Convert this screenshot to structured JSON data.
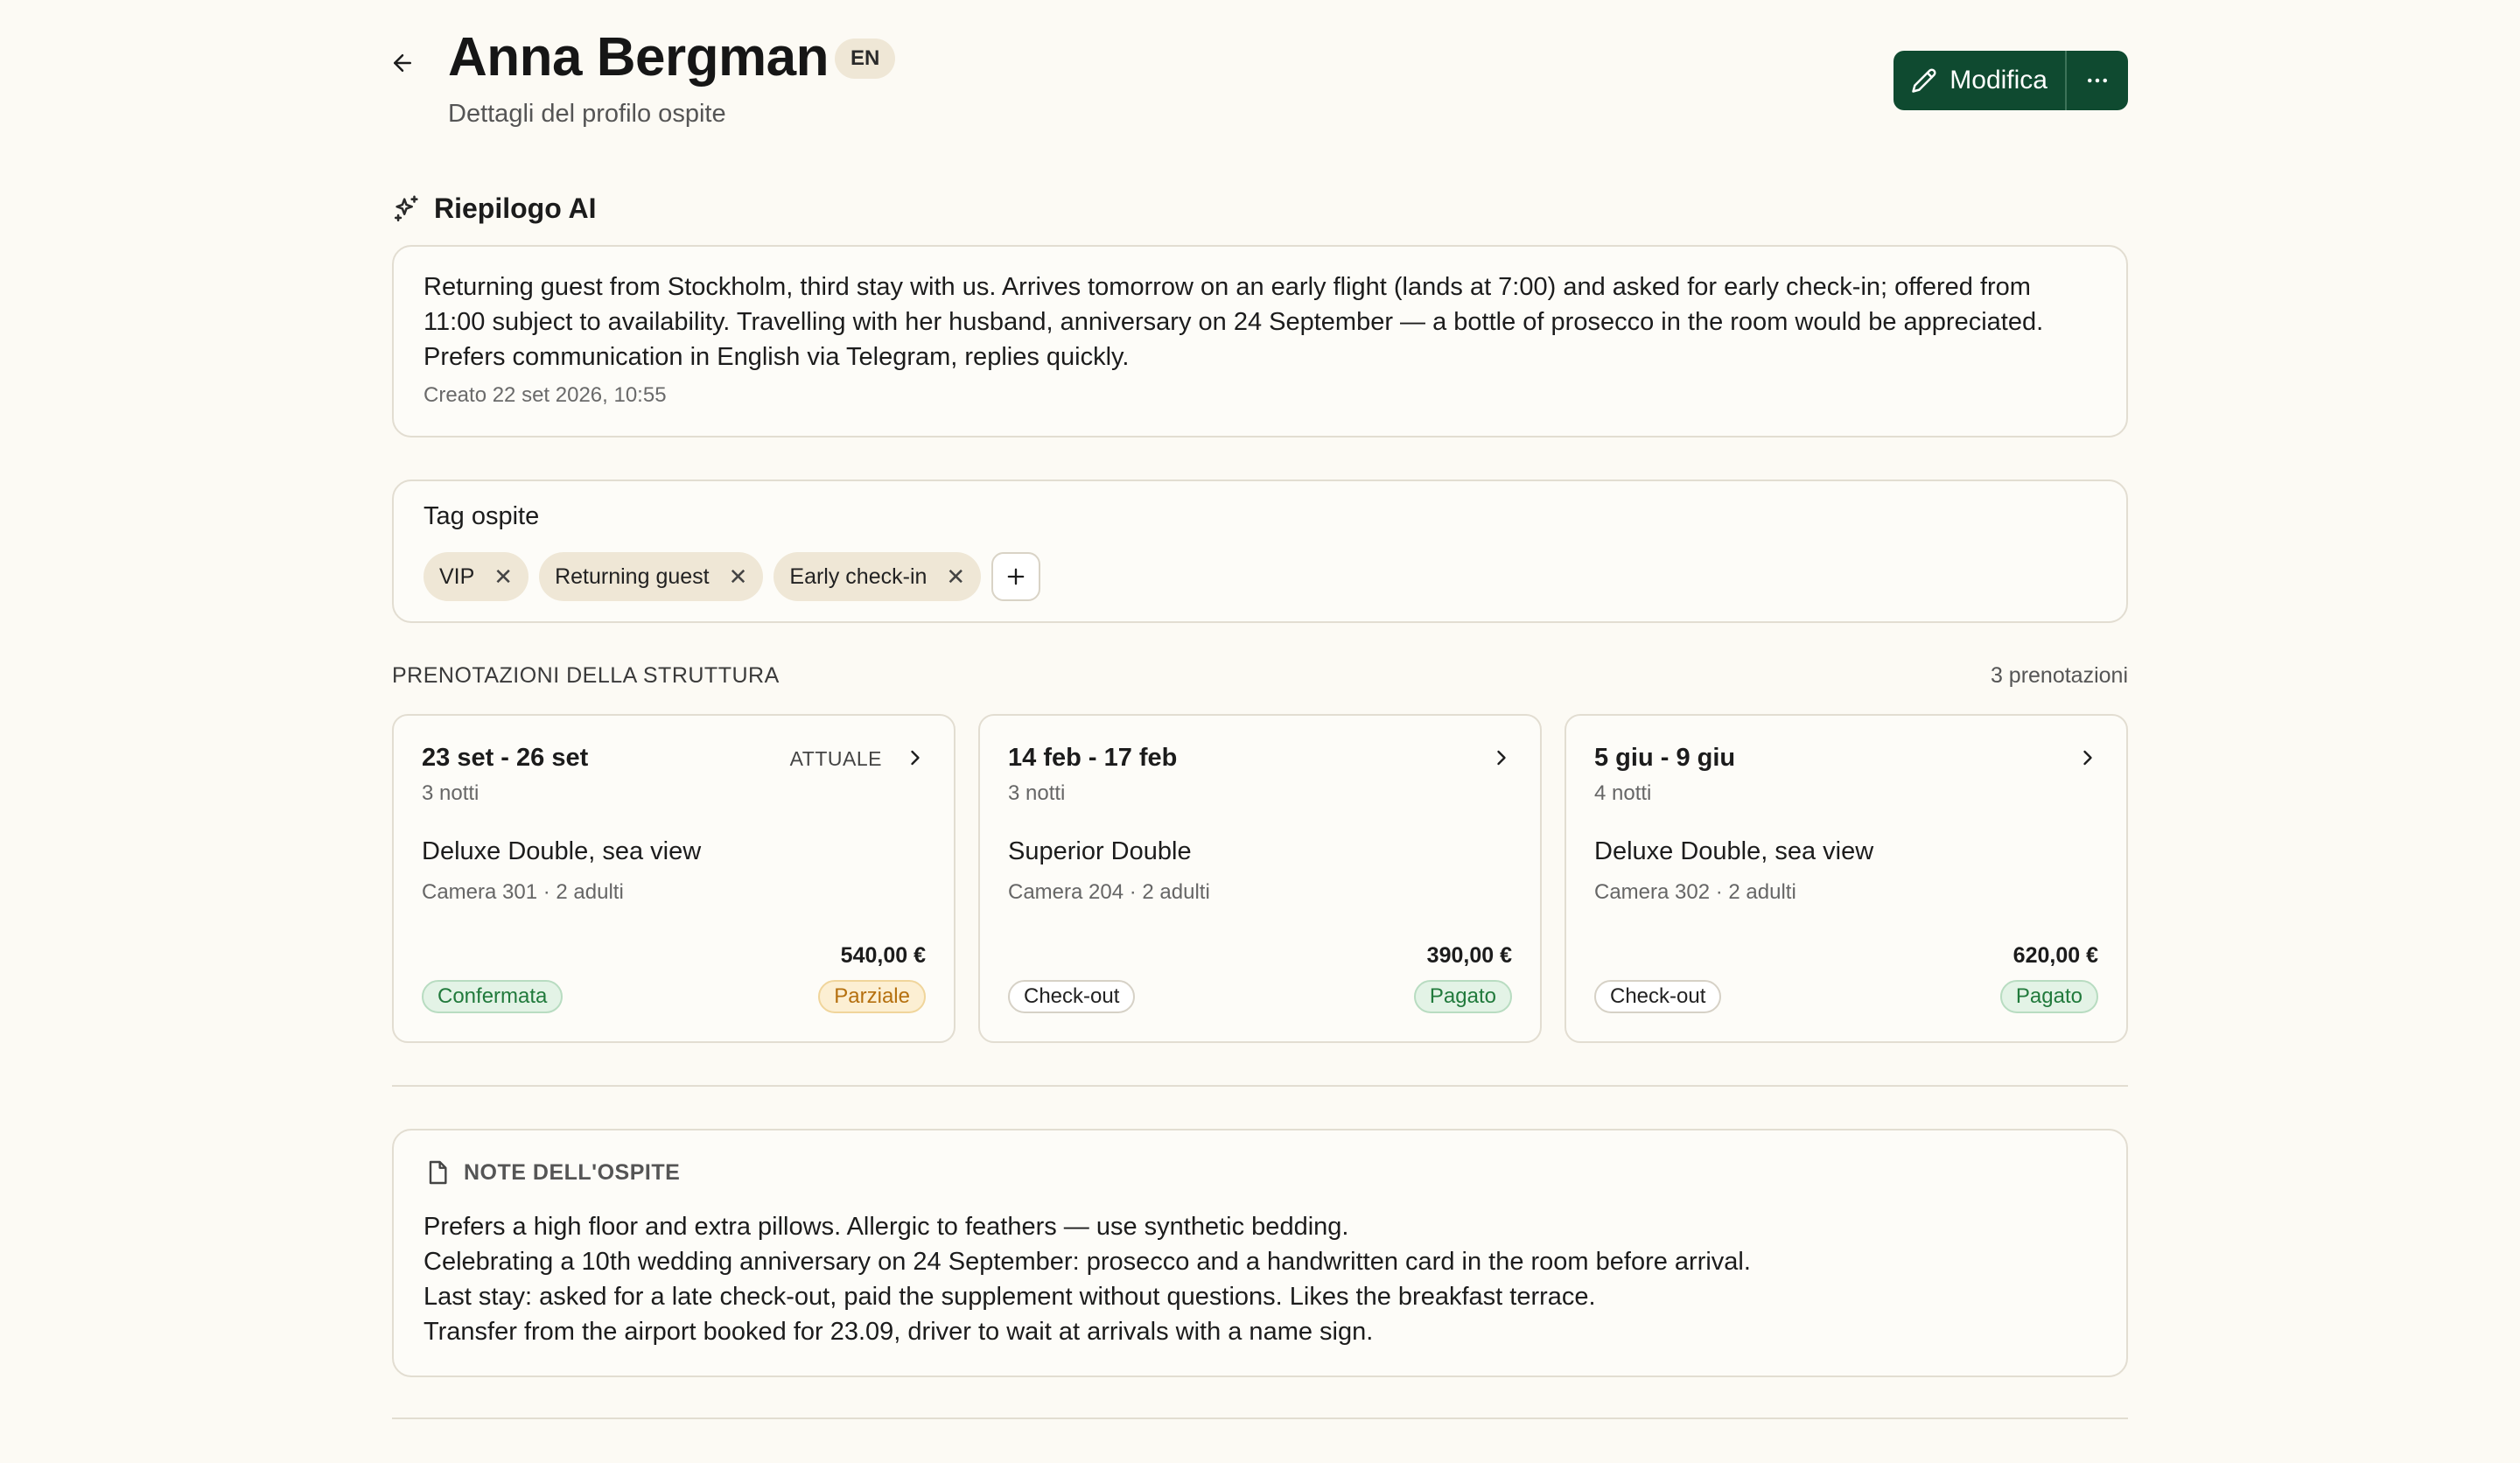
{
  "header": {
    "guest_name": "Anna Bergman",
    "language": "EN",
    "subtitle": "Dettagli del profilo ospite",
    "edit_label": "Modifica"
  },
  "ai_summary": {
    "title": "Riepilogo AI",
    "text": "Returning guest from Stockholm, third stay with us. Arrives tomorrow on an early flight (lands at 7:00) and asked for early check-in; offered from 11:00 subject to availability. Travelling with her husband, anniversary on 24 September — a bottle of prosecco in the room would be appreciated. Prefers communication in English via Telegram, replies quickly.",
    "created": "Creato 22 set 2026, 10:55"
  },
  "tags": {
    "title": "Tag ospite",
    "items": [
      "VIP",
      "Returning guest",
      "Early check-in"
    ]
  },
  "bookings": {
    "title": "PRENOTAZIONI DELLA STRUTTURA",
    "count": "3 prenotazioni",
    "items": [
      {
        "dates": "23 set - 26 set",
        "nights": "3 notti",
        "current": "ATTUALE",
        "room": "Deluxe Double, sea view",
        "meta": "Camera 301 · 2 adulti",
        "amount": "540,00 €",
        "status": "Confermata",
        "payment": "Parziale"
      },
      {
        "dates": "14 feb - 17 feb",
        "nights": "3 notti",
        "room": "Superior Double",
        "meta": "Camera 204 · 2 adulti",
        "amount": "390,00 €",
        "status": "Check-out",
        "payment": "Pagato"
      },
      {
        "dates": "5 giu - 9 giu",
        "nights": "4 notti",
        "room": "Deluxe Double, sea view",
        "meta": "Camera 302 · 2 adulti",
        "amount": "620,00 €",
        "status": "Check-out",
        "payment": "Pagato"
      }
    ]
  },
  "notes": {
    "title": "NOTE DELL'OSPITE",
    "lines": [
      "Prefers a high floor and extra pillows. Allergic to feathers — use synthetic bedding.",
      "Celebrating a 10th wedding anniversary on 24 September: prosecco and a handwritten card in the room before arrival.",
      "Last stay: asked for a late check-out, paid the supplement without questions. Likes the breakfast terrace.",
      "Transfer from the airport booked for 23.09, driver to wait at arrivals with a name sign."
    ]
  },
  "colors": {
    "primary": "#0f4a30",
    "background": "#fcfaf4",
    "tag_bg": "#efe7d6",
    "status_green": "#217a3c",
    "status_amber": "#b5700f"
  },
  "icons": {
    "back": "arrow-left-icon",
    "edit": "pencil-icon",
    "more": "ellipsis-icon",
    "ai": "sparkles-icon",
    "remove_tag": "close-icon",
    "add_tag": "plus-icon",
    "booking_open": "chevron-right-icon",
    "notes": "document-icon"
  }
}
